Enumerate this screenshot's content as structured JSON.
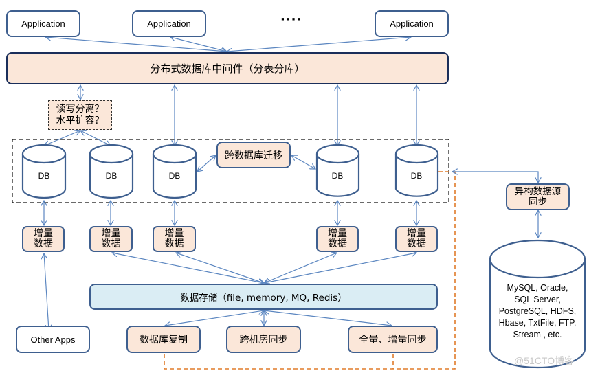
{
  "applications": [
    {
      "label": "Application"
    },
    {
      "label": "Application"
    },
    {
      "label": "Application"
    }
  ],
  "ellipsis": "····",
  "middleware": {
    "label": "分布式数据库中间件（分表分库）"
  },
  "question_box": {
    "label": "读写分离？\n水平扩容？"
  },
  "databases": [
    {
      "label": "DB"
    },
    {
      "label": "DB"
    },
    {
      "label": "DB"
    },
    {
      "label": "DB"
    },
    {
      "label": "DB"
    }
  ],
  "cross_db_migration": {
    "label": "跨数据库迁移"
  },
  "incremental_data": [
    {
      "label": "增量\n数据"
    },
    {
      "label": "增量\n数据"
    },
    {
      "label": "增量\n数据"
    },
    {
      "label": "增量\n数据"
    },
    {
      "label": "增量\n数据"
    }
  ],
  "data_storage": {
    "label": "数据存储（file, memory, MQ, Redis）"
  },
  "other_apps": {
    "label": "Other Apps"
  },
  "sync_boxes": [
    {
      "label": "数据库复制"
    },
    {
      "label": "跨机房同步"
    },
    {
      "label": "全量、增量同步"
    }
  ],
  "hetero_sync": {
    "label": "异构数据源\n同步"
  },
  "hetero_sources": {
    "label": "MySQL, Oracle,\nSQL Server,\nPostgreSQL, HDFS,\nHbase, TxtFile, FTP,\nStream , etc."
  },
  "watermark": "@51CTO博客",
  "colors": {
    "box_border": "#3e5f8f",
    "middleware_border": "#1a2e5a",
    "peach_fill": "#fbe7d9",
    "storage_fill": "#daedf4",
    "arrow": "#5b86c0",
    "orange_dashed": "#e07b2a"
  }
}
